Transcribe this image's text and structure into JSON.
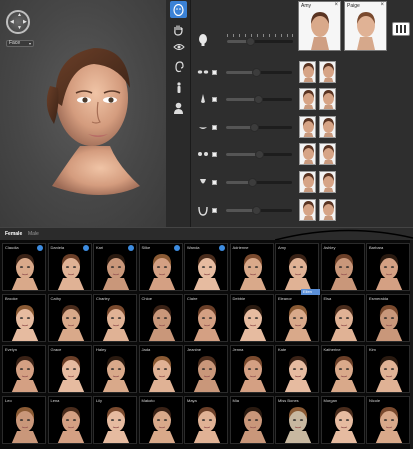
{
  "viewport": {
    "view_label": "Face",
    "nav_icons": [
      "arrow-up",
      "arrow-down",
      "arrow-left",
      "arrow-right"
    ]
  },
  "toolbar": {
    "tools": [
      {
        "name": "face-tool-icon",
        "active": true
      },
      {
        "name": "hand-tool-icon",
        "active": false
      },
      {
        "name": "eye-tool-icon",
        "active": false
      },
      {
        "name": "ear-tool-icon",
        "active": false
      },
      {
        "name": "body-tool-icon",
        "active": false
      },
      {
        "name": "bust-tool-icon",
        "active": false
      }
    ]
  },
  "blend": {
    "cards": [
      {
        "name": "Amy",
        "close": "×"
      },
      {
        "name": "Paige",
        "close": "×"
      }
    ],
    "main_slider_level": 0.35
  },
  "features": {
    "rows": [
      {
        "icon": "eyes-icon",
        "level": 0.45
      },
      {
        "icon": "nose-icon",
        "level": 0.48
      },
      {
        "icon": "mouth-icon",
        "level": 0.42
      },
      {
        "icon": "cheeks-icon",
        "level": 0.5
      },
      {
        "icon": "chin-icon",
        "level": 0.4
      },
      {
        "icon": "jaw-icon",
        "level": 0.46
      }
    ]
  },
  "library": {
    "tabs": [
      "Female",
      "Male"
    ],
    "active_tab": "Female",
    "tooltip": "Ellen",
    "models": [
      {
        "name": "Claudia",
        "badge": true
      },
      {
        "name": "Daniela",
        "badge": true
      },
      {
        "name": "Kari",
        "badge": true
      },
      {
        "name": "Silke",
        "badge": true
      },
      {
        "name": "Wanda",
        "badge": true
      },
      {
        "name": "Adrienne",
        "badge": false
      },
      {
        "name": "Amy",
        "badge": false
      },
      {
        "name": "Ashley",
        "badge": false
      },
      {
        "name": "Barbara",
        "badge": false
      },
      {
        "name": "Brooke",
        "badge": false
      },
      {
        "name": "Cathy",
        "badge": false
      },
      {
        "name": "Charley",
        "badge": false
      },
      {
        "name": "Chloe",
        "badge": false
      },
      {
        "name": "Claire",
        "badge": false
      },
      {
        "name": "Debbie",
        "badge": false
      },
      {
        "name": "Eleanor",
        "badge": false
      },
      {
        "name": "Elsa",
        "badge": false
      },
      {
        "name": "Esmeralda",
        "badge": false
      },
      {
        "name": "Evelyn",
        "badge": false
      },
      {
        "name": "Grace",
        "badge": false
      },
      {
        "name": "Haley",
        "badge": false
      },
      {
        "name": "Jada",
        "badge": false
      },
      {
        "name": "Jeanine",
        "badge": false
      },
      {
        "name": "Jenna",
        "badge": false
      },
      {
        "name": "Kate",
        "badge": false
      },
      {
        "name": "Katherine",
        "badge": false
      },
      {
        "name": "Kim",
        "badge": false
      },
      {
        "name": "Leo",
        "badge": false
      },
      {
        "name": "Lena",
        "badge": false
      },
      {
        "name": "Lily",
        "badge": false
      },
      {
        "name": "Makoto",
        "badge": false
      },
      {
        "name": "Maya",
        "badge": false
      },
      {
        "name": "Mia",
        "badge": false
      },
      {
        "name": "Miss Bones",
        "badge": false
      },
      {
        "name": "Morgan",
        "badge": false
      },
      {
        "name": "Nicole",
        "badge": false
      }
    ]
  },
  "colors": {
    "accent": "#3b82d6",
    "panel": "#2e2e2e",
    "viewport": "#474747",
    "skin": "#d9a98a",
    "hair": "#5a3422"
  }
}
